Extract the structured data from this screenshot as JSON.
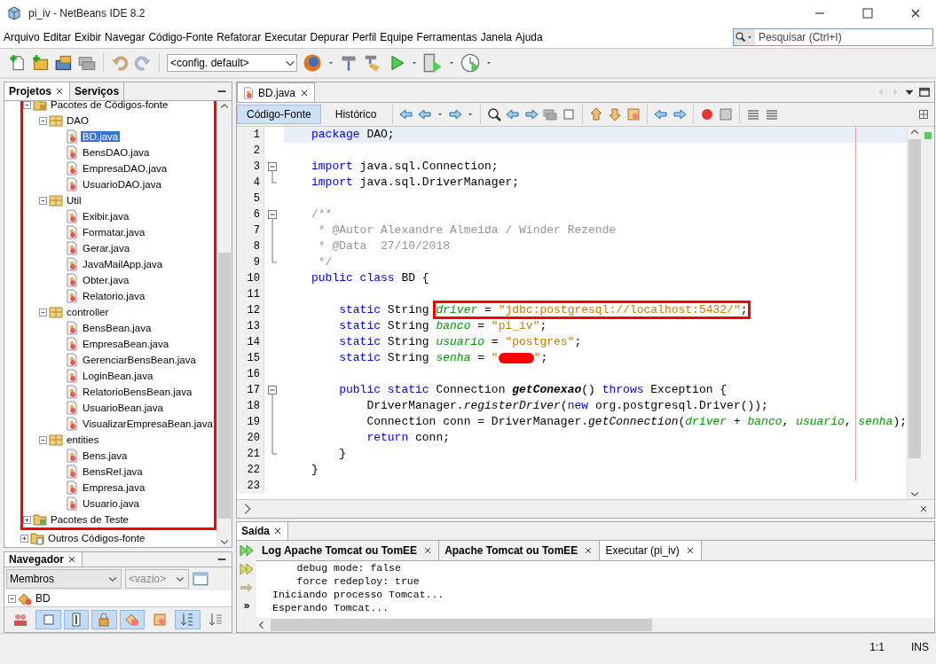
{
  "window": {
    "title": "pi_iv - NetBeans IDE 8.2"
  },
  "menu": [
    "Arquivo",
    "Editar",
    "Exibir",
    "Navegar",
    "Código-Fonte",
    "Refatorar",
    "Executar",
    "Depurar",
    "Perfil",
    "Equipe",
    "Ferramentas",
    "Janela",
    "Ajuda"
  ],
  "search": {
    "placeholder": "Pesquisar (Ctrl+I)"
  },
  "toolbar": {
    "configuration": "<config. default>"
  },
  "projects_panel": {
    "tabs": [
      {
        "label": "Projetos",
        "selected": true
      },
      {
        "label": "Serviços",
        "selected": false
      }
    ],
    "framed_nodes": [
      {
        "label": "Pacotes de Códigos-fonte",
        "kind": "source-root",
        "expanded": true,
        "selected": false,
        "children": [
          {
            "label": "DAO",
            "kind": "package",
            "expanded": true,
            "selected": false,
            "children": [
              {
                "label": "BD.java",
                "kind": "file",
                "selected": true
              },
              {
                "label": "BensDAO.java",
                "kind": "file",
                "selected": false
              },
              {
                "label": "EmpresaDAO.java",
                "kind": "file",
                "selected": false
              },
              {
                "label": "UsuarioDAO.java",
                "kind": "file",
                "selected": false
              }
            ]
          },
          {
            "label": "Util",
            "kind": "package",
            "expanded": true,
            "selected": false,
            "children": [
              {
                "label": "Exibir.java",
                "kind": "file",
                "selected": false
              },
              {
                "label": "Formatar.java",
                "kind": "file",
                "selected": false
              },
              {
                "label": "Gerar.java",
                "kind": "file",
                "selected": false
              },
              {
                "label": "JavaMailApp.java",
                "kind": "file",
                "selected": false
              },
              {
                "label": "Obter.java",
                "kind": "file",
                "selected": false
              },
              {
                "label": "Relatorio.java",
                "kind": "file",
                "selected": false
              }
            ]
          },
          {
            "label": "controller",
            "kind": "package",
            "expanded": true,
            "selected": false,
            "children": [
              {
                "label": "BensBean.java",
                "kind": "file",
                "selected": false
              },
              {
                "label": "EmpresaBean.java",
                "kind": "file",
                "selected": false
              },
              {
                "label": "GerenciarBensBean.java",
                "kind": "file",
                "selected": false
              },
              {
                "label": "LoginBean.java",
                "kind": "file",
                "selected": false
              },
              {
                "label": "RelatorioBensBean.java",
                "kind": "file",
                "selected": false
              },
              {
                "label": "UsuarioBean.java",
                "kind": "file",
                "selected": false
              },
              {
                "label": "VisualizarEmpresaBean.java",
                "kind": "file",
                "selected": false
              }
            ]
          },
          {
            "label": "entities",
            "kind": "package",
            "expanded": true,
            "selected": false,
            "children": [
              {
                "label": "Bens.java",
                "kind": "file",
                "selected": false
              },
              {
                "label": "BensRel.java",
                "kind": "file",
                "selected": false
              },
              {
                "label": "Empresa.java",
                "kind": "file",
                "selected": false
              },
              {
                "label": "Usuario.java",
                "kind": "file",
                "selected": false
              }
            ]
          }
        ]
      },
      {
        "label": "Pacotes de Teste",
        "kind": "test-root",
        "expanded": false,
        "selected": false
      }
    ],
    "other_nodes": [
      {
        "label": "Outros Códigos-fonte",
        "kind": "other-root",
        "expanded": false,
        "selected": false
      }
    ]
  },
  "navigator": {
    "title": "Navegador",
    "members_filter": "Membros",
    "context": {
      "value": "<vazio>",
      "disabled": true
    },
    "nodes": [
      {
        "label": "BD",
        "expanded": true,
        "selected": false
      }
    ],
    "filter_buttons": [
      {
        "selected": false
      },
      {
        "selected": true
      },
      {
        "selected": true
      },
      {
        "selected": true
      },
      {
        "selected": true
      },
      {
        "selected": false
      },
      {
        "selected": true
      },
      {
        "selected": false
      }
    ]
  },
  "editor": {
    "tabs": [
      {
        "label": "BD.java",
        "selected": true
      }
    ],
    "views": [
      {
        "label": "Código-Fonte",
        "selected": true
      },
      {
        "label": "Histórico",
        "selected": false
      }
    ],
    "lines": [
      {
        "number": "1",
        "current": true,
        "tokens": [
          {
            "kind": "keyword",
            "text": "package"
          },
          {
            "kind": "plain",
            "text": " DAO;"
          }
        ]
      },
      {
        "number": "2",
        "current": false
      },
      {
        "number": "3",
        "current": false,
        "fold_expanded": true,
        "tokens": [
          {
            "kind": "keyword",
            "text": "import"
          },
          {
            "kind": "plain",
            "text": " java.sql.Connection;"
          }
        ]
      },
      {
        "number": "4",
        "current": false,
        "fold_end": true,
        "tokens": [
          {
            "kind": "keyword",
            "text": "import"
          },
          {
            "kind": "plain",
            "text": " java.sql.DriverManager;"
          }
        ]
      },
      {
        "number": "5",
        "current": false
      },
      {
        "number": "6",
        "current": false,
        "fold_expanded": true,
        "tokens": [
          {
            "kind": "comment",
            "text": "/**"
          }
        ]
      },
      {
        "number": "7",
        "current": false,
        "in_fold": true,
        "tokens": [
          {
            "kind": "comment",
            "text": " * @Autor Alexandre Almeida / Winder Rezende"
          }
        ]
      },
      {
        "number": "8",
        "current": false,
        "in_fold": true,
        "tokens": [
          {
            "kind": "comment",
            "text": " * @Data  27/10/2018"
          }
        ]
      },
      {
        "number": "9",
        "current": false,
        "fold_end": true,
        "tokens": [
          {
            "kind": "comment",
            "text": " */"
          }
        ]
      },
      {
        "number": "10",
        "current": false,
        "tokens": [
          {
            "kind": "keyword",
            "text": "public class"
          },
          {
            "kind": "plain",
            "text": " BD {"
          }
        ]
      },
      {
        "number": "11",
        "current": false
      },
      {
        "number": "12",
        "current": false,
        "tokens": [
          {
            "kind": "keyword",
            "text": "    static"
          },
          {
            "kind": "plain",
            "text": " String "
          }
        ],
        "boxed_tokens": [
          {
            "kind": "field",
            "text": "driver"
          },
          {
            "kind": "plain",
            "text": " = "
          },
          {
            "kind": "string",
            "text": "\"jdbc:postgresql://localhost:5432/\""
          },
          {
            "kind": "plain",
            "text": ";"
          }
        ]
      },
      {
        "number": "13",
        "current": false,
        "tokens": [
          {
            "kind": "keyword",
            "text": "    static"
          },
          {
            "kind": "plain",
            "text": " String "
          },
          {
            "kind": "field",
            "text": "banco"
          },
          {
            "kind": "plain",
            "text": " = "
          },
          {
            "kind": "string",
            "text": "\"pi_iv\""
          },
          {
            "kind": "plain",
            "text": ";"
          }
        ]
      },
      {
        "number": "14",
        "current": false,
        "tokens": [
          {
            "kind": "keyword",
            "text": "    static"
          },
          {
            "kind": "plain",
            "text": " String "
          },
          {
            "kind": "field",
            "text": "usuario"
          },
          {
            "kind": "plain",
            "text": " = "
          },
          {
            "kind": "string",
            "text": "\"postgres\""
          },
          {
            "kind": "plain",
            "text": ";"
          }
        ]
      },
      {
        "number": "15",
        "current": false,
        "tokens": [
          {
            "kind": "keyword",
            "text": "    static"
          },
          {
            "kind": "plain",
            "text": " String "
          },
          {
            "kind": "field",
            "text": "senha"
          },
          {
            "kind": "plain",
            "text": " = "
          },
          {
            "kind": "string",
            "text": "\""
          },
          {
            "kind": "redaction"
          },
          {
            "kind": "string",
            "text": "\""
          },
          {
            "kind": "plain",
            "text": ";"
          }
        ]
      },
      {
        "number": "16",
        "current": false
      },
      {
        "number": "17",
        "current": false,
        "fold_expanded": true,
        "tokens": [
          {
            "kind": "keyword",
            "text": "    public static"
          },
          {
            "kind": "plain",
            "text": " Connection "
          },
          {
            "kind": "method-declaration",
            "text": "getConexao"
          },
          {
            "kind": "plain",
            "text": "() "
          },
          {
            "kind": "keyword",
            "text": "throws"
          },
          {
            "kind": "plain",
            "text": " Exception {"
          }
        ]
      },
      {
        "number": "18",
        "current": false,
        "in_fold": true,
        "tokens": [
          {
            "kind": "plain",
            "text": "        DriverManager."
          },
          {
            "kind": "static-method",
            "text": "registerDriver"
          },
          {
            "kind": "plain",
            "text": "("
          },
          {
            "kind": "keyword",
            "text": "new"
          },
          {
            "kind": "plain",
            "text": " org.postgresql.Driver());"
          }
        ]
      },
      {
        "number": "19",
        "current": false,
        "in_fold": true,
        "tokens": [
          {
            "kind": "plain",
            "text": "        Connection conn = DriverManager."
          },
          {
            "kind": "static-method",
            "text": "getConnection"
          },
          {
            "kind": "plain",
            "text": "("
          },
          {
            "kind": "field",
            "text": "driver"
          },
          {
            "kind": "plain",
            "text": " + "
          },
          {
            "kind": "field",
            "text": "banco"
          },
          {
            "kind": "plain",
            "text": ", "
          },
          {
            "kind": "field",
            "text": "usuario"
          },
          {
            "kind": "plain",
            "text": ", "
          },
          {
            "kind": "field",
            "text": "senha"
          },
          {
            "kind": "plain",
            "text": ");"
          }
        ]
      },
      {
        "number": "20",
        "current": false,
        "in_fold": true,
        "tokens": [
          {
            "kind": "keyword",
            "text": "        return"
          },
          {
            "kind": "plain",
            "text": " conn;"
          }
        ]
      },
      {
        "number": "21",
        "current": false,
        "fold_end": true,
        "tokens": [
          {
            "kind": "plain",
            "text": "    }"
          }
        ]
      },
      {
        "number": "22",
        "current": false,
        "tokens": [
          {
            "kind": "plain",
            "text": "}"
          }
        ]
      },
      {
        "number": "23",
        "current": false
      }
    ]
  },
  "output": {
    "title": "Saída",
    "tabs": [
      {
        "label": "Log Apache Tomcat ou TomEE",
        "selected": false
      },
      {
        "label": "Apache Tomcat ou TomEE",
        "selected": false
      },
      {
        "label": "Executar (pi_iv)",
        "selected": true
      }
    ],
    "more": "»",
    "lines": [
      "    debug mode: false",
      "    force redeploy: true",
      "Iniciando processo Tomcat...",
      "Esperando Tomcat..."
    ]
  },
  "status_bar": {
    "position": "1:1",
    "mode": "INS"
  }
}
